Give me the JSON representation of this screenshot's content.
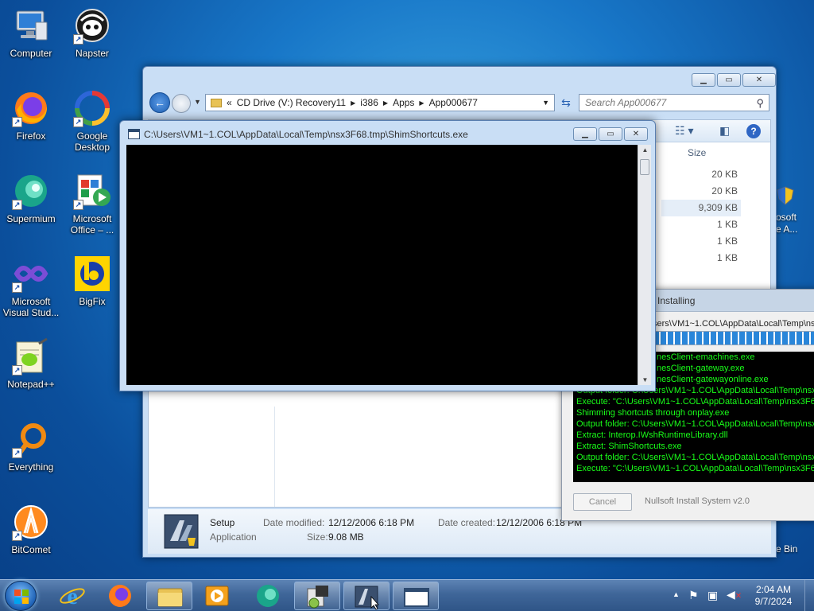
{
  "desktop": {
    "icons": [
      {
        "label": "Computer"
      },
      {
        "label": "Napster"
      },
      {
        "label": "Firefox"
      },
      {
        "label": "Google Desktop"
      },
      {
        "label": "Supermium"
      },
      {
        "label": "Microsoft Office – ..."
      },
      {
        "label": "Microsoft Visual Stud..."
      },
      {
        "label": "BigFix"
      },
      {
        "label": "Notepad++"
      },
      {
        "label": "Everything"
      },
      {
        "label": "BitComet"
      }
    ],
    "partial_right": {
      "text1": "osoft",
      "text2": "e A...",
      "text3": "e Bin"
    }
  },
  "explorer": {
    "breadcrumb": [
      "CD Drive (V:) Recovery11",
      "i386",
      "Apps",
      "App000677"
    ],
    "breadcrumb_prefix": "«",
    "search_placeholder": "Search App000677",
    "column_size": "Size",
    "sizes": [
      "20 KB",
      "20 KB",
      "9,309 KB",
      "1 KB",
      "1 KB",
      "1 KB"
    ],
    "details": {
      "name": "Setup",
      "type": "Application",
      "modified_label": "Date modified:",
      "modified_value": "12/12/2006 6:18 PM",
      "created_label": "Date created:",
      "created_value": "12/12/2006 6:18 PM",
      "size_label": "Size:",
      "size_value": "9.08 MB"
    }
  },
  "console": {
    "title": "C:\\Users\\VM1~1.COL\\AppData\\Local\\Temp\\nsx3F68.tmp\\ShimShortcuts.exe"
  },
  "installer": {
    "title": "Installing",
    "path": "sers\\VM1~1.COL\\AppData\\Local\\Temp\\ns",
    "progress": 1.0,
    "log": [
      "nesClient-emachines.exe",
      "nesClient-gateway.exe",
      "nesClient-gatewayonline.exe",
      "Output folder: C:\\Users\\VM1~1.COL\\AppData\\Local\\Temp\\nsx",
      "Execute: \"C:\\Users\\VM1~1.COL\\AppData\\Local\\Temp\\nsx3F6",
      "Shimming shortcuts through onplay.exe",
      "Output folder: C:\\Users\\VM1~1.COL\\AppData\\Local\\Temp\\nsx",
      "Extract: Interop.IWshRuntimeLibrary.dll",
      "Extract: ShimShortcuts.exe",
      "Output folder: C:\\Users\\VM1~1.COL\\AppData\\Local\\Temp\\nsx",
      "Execute: \"C:\\Users\\VM1~1.COL\\AppData\\Local\\Temp\\nsx3F6"
    ],
    "cancel_label": "Cancel",
    "brand": "Nullsoft Install System v2.0"
  },
  "taskbar": {
    "time": "2:04 AM",
    "date": "9/7/2024"
  }
}
